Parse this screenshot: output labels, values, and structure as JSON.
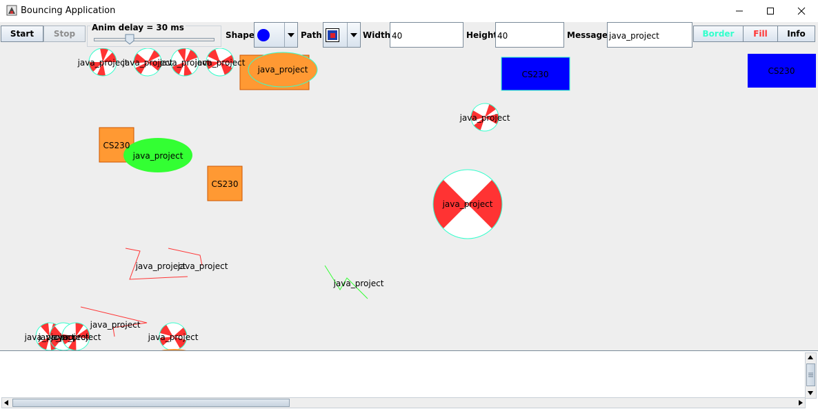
{
  "window": {
    "title": "Bouncing Application",
    "minimize_glyph": "—",
    "maximize_glyph": "☐",
    "close_glyph": "✕"
  },
  "toolbar": {
    "start_label": "Start",
    "stop_label": "Stop",
    "slider_label": "Anim delay = 30 ms",
    "slider_value_ms": 30,
    "shape_label": "Shape:",
    "shape_selected": "circle",
    "path_label": "Path:",
    "path_selected": "bouncing",
    "width_label": "Width:",
    "width_value": "40",
    "height_label": "Height:",
    "height_value": "40",
    "message_label": "Message:",
    "message_value": "java_project",
    "border_label": "Border",
    "fill_label": "Fill",
    "info_label": "Info"
  },
  "colors": {
    "orange": "#ff9933",
    "blue": "#0000ff",
    "green": "#33ff33",
    "red": "#ff3333",
    "cyan": "#33ffcc",
    "border_button_text": "#33ffcc",
    "fill_button_text": "#ff3333"
  },
  "canvas": {
    "texts": {
      "t1": "java_project",
      "t2": "java_project",
      "t3": "java_project",
      "t4": "java_project",
      "t5": "java_project",
      "t6": "CS230",
      "t7": "CS230",
      "t8": "java_project",
      "t9": "java_project",
      "t10": "CS230",
      "t11": "CS230",
      "t12": "java_project",
      "t13": "java_project",
      "t14": "java_project",
      "t15": "java_project",
      "t16": "java_project",
      "t17": "java_project",
      "t18": "java_project",
      "t19": "java_project",
      "t20": "java_project"
    }
  }
}
